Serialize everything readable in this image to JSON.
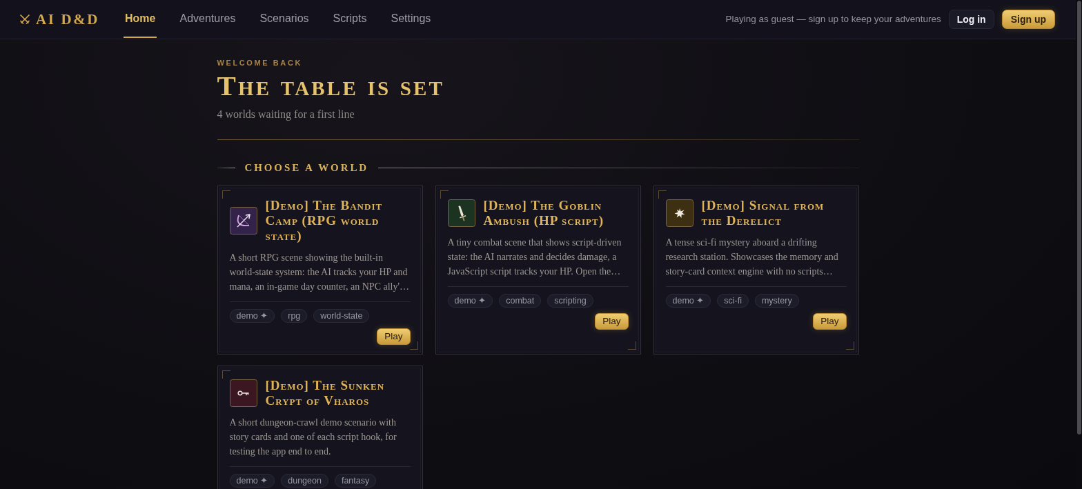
{
  "brand": {
    "name": "AI D&D"
  },
  "nav": [
    {
      "label": "Home",
      "selected": true
    },
    {
      "label": "Adventures",
      "selected": false
    },
    {
      "label": "Scenarios",
      "selected": false
    },
    {
      "label": "Scripts",
      "selected": false
    },
    {
      "label": "Settings",
      "selected": false
    }
  ],
  "account": {
    "note": "Playing as guest — sign up to keep your adventures",
    "login": "Log in",
    "signup": "Sign up"
  },
  "hero": {
    "eyebrow": "WELCOME BACK",
    "title": "The table is set",
    "subtitle": "4 worlds waiting for a first line"
  },
  "section": {
    "title": "CHOOSE A WORLD"
  },
  "worlds": [
    {
      "title": "[Demo] The Bandit Camp (RPG world state)",
      "color": "#33234a",
      "description": "A short RPG scene showing the built-in world-state system: the AI tracks your HP and mana, an in-game day counter, an NPC ally'…",
      "tags": [
        "demo ✦",
        "rpg",
        "world-state"
      ],
      "action": "Play"
    },
    {
      "title": "[Demo] The Goblin Ambush (HP script)",
      "color": "#1b3320",
      "description": "A tiny combat scene that shows script-driven state: the AI narrates and decides damage, a JavaScript script tracks your HP. Open the…",
      "tags": [
        "demo ✦",
        "combat",
        "scripting"
      ],
      "action": "Play"
    },
    {
      "title": "[Demo] Signal from the Derelict",
      "color": "#3d2f12",
      "description": "A tense sci-fi mystery aboard a drifting research station. Showcases the memory and story-card context engine with no scripts…",
      "tags": [
        "demo ✦",
        "sci-fi",
        "mystery"
      ],
      "action": "Play"
    },
    {
      "title": "[Demo] The Sunken Crypt of Vharos",
      "color": "#3b1722",
      "description": "A short dungeon-crawl demo scenario with story cards and one of each script hook, for testing the app end to end.",
      "tags": [
        "demo ✦",
        "dungeon",
        "fantasy"
      ]
    }
  ]
}
